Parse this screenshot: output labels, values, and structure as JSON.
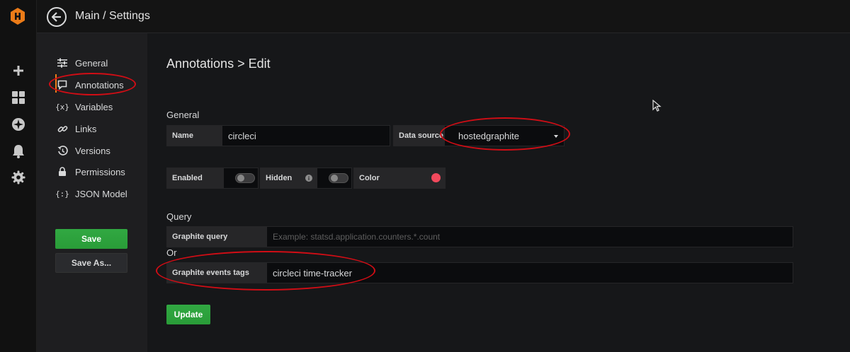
{
  "topbar": {
    "breadcrumb": "Main / Settings"
  },
  "sidebar": {
    "icons": [
      "plus-icon",
      "dashboards-icon",
      "explore-icon",
      "alerting-bell-icon",
      "configuration-gear-icon"
    ]
  },
  "settings_nav": {
    "items": [
      {
        "label": "General",
        "icon": "sliders-icon"
      },
      {
        "label": "Annotations",
        "icon": "comment-icon",
        "active": true
      },
      {
        "label": "Variables",
        "icon": "variable-icon"
      },
      {
        "label": "Links",
        "icon": "link-icon"
      },
      {
        "label": "Versions",
        "icon": "history-icon"
      },
      {
        "label": "Permissions",
        "icon": "lock-icon"
      },
      {
        "label": "JSON Model",
        "icon": "json-icon"
      }
    ],
    "save_label": "Save",
    "save_as_label": "Save As..."
  },
  "main": {
    "title": "Annotations > Edit",
    "general": {
      "section": "General",
      "name_label": "Name",
      "name_value": "circleci",
      "datasource_label": "Data source",
      "datasource_value": "hostedgraphite",
      "enabled_label": "Enabled",
      "hidden_label": "Hidden",
      "color_label": "Color",
      "color_value": "#f2495c"
    },
    "query": {
      "section": "Query",
      "graphite_query_label": "Graphite query",
      "graphite_query_placeholder": "Example: statsd.application.counters.*.count",
      "or_label": "Or",
      "events_tags_label": "Graphite events tags",
      "events_tags_value": "circleci time-tracker"
    },
    "update_label": "Update"
  },
  "colors": {
    "accent": "#eb7b18",
    "primary_button": "#299c38",
    "annotation_marker": "#d10d15"
  }
}
